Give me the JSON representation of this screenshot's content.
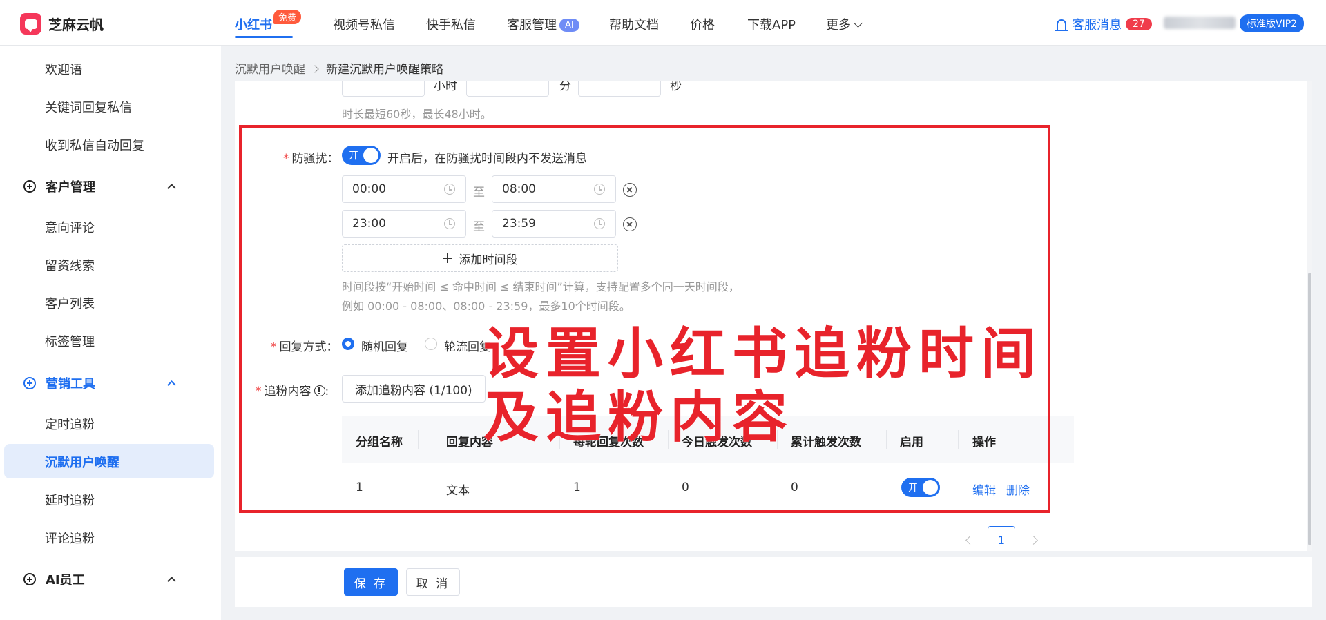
{
  "brand": {
    "name": "芝麻云帆"
  },
  "nav": {
    "items": [
      "小红书",
      "视频号私信",
      "快手私信",
      "客服管理",
      "帮助文档",
      "价格",
      "下载APP",
      "更多"
    ],
    "free_badge": "免费",
    "ai_badge": "AI",
    "messages_label": "客服消息",
    "messages_count": "27",
    "vip_label": "标准版VIP2"
  },
  "sidebar": {
    "top_items": [
      "欢迎语",
      "关键词回复私信",
      "收到私信自动回复"
    ],
    "groups": [
      {
        "label": "客户管理",
        "items": [
          "意向评论",
          "留资线索",
          "客户列表",
          "标签管理"
        ]
      },
      {
        "label": "营销工具",
        "items": [
          "定时追粉",
          "沉默用户唤醒",
          "延时追粉",
          "评论追粉"
        ]
      },
      {
        "label": "AI员工",
        "items": []
      }
    ],
    "active_item": "沉默用户唤醒"
  },
  "breadcrumb": {
    "parent": "沉默用户唤醒",
    "current": "新建沉默用户唤醒策略"
  },
  "form": {
    "duration_units": [
      "小时",
      "分",
      "秒"
    ],
    "duration_hint": "时长最短60秒，最长48小时。",
    "dnd": {
      "label": "防骚扰",
      "toggle_label": "开",
      "description": "开启后，在防骚扰时间段内不发送消息",
      "periods": [
        {
          "start": "00:00",
          "end": "08:00"
        },
        {
          "start": "23:00",
          "end": "23:59"
        }
      ],
      "to_label": "至",
      "add_label": "添加时间段",
      "hint_line1": "时间段按“开始时间 ≤ 命中时间 ≤ 结束时间”计算，支持配置多个同一天时间段，",
      "hint_line2": "例如 00:00 - 08:00、08:00 - 23:59，最多10个时间段。"
    },
    "reply_mode": {
      "label": "回复方式",
      "options": [
        "随机回复",
        "轮流回复"
      ],
      "selected": "随机回复"
    },
    "follow_content": {
      "label": "追粉内容",
      "add_button": "添加追粉内容 (1/100)"
    },
    "table": {
      "columns": [
        "分组名称",
        "回复内容",
        "每轮回复次数",
        "今日触发次数",
        "累计触发次数",
        "启用",
        "操作"
      ],
      "rows": [
        {
          "group": "1",
          "content": "文本",
          "per_round": "1",
          "today": "0",
          "total": "0",
          "enabled_label": "开",
          "actions": [
            "编辑",
            "删除"
          ]
        }
      ]
    },
    "pagination": {
      "current": "1"
    }
  },
  "footer": {
    "save_label": "保 存",
    "cancel_label": "取 消"
  },
  "annotation": {
    "line1": "设置小红书追粉时间",
    "line2": "及追粉内容",
    "color": "#e8232b"
  },
  "colors": {
    "accent": "#1f6ff0",
    "brand": "#f5375a"
  }
}
